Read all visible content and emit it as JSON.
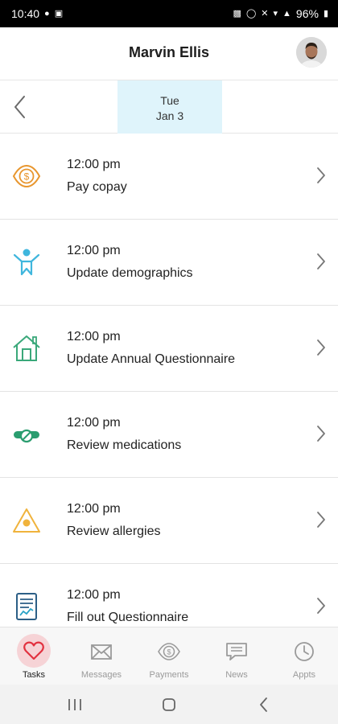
{
  "status_bar": {
    "time": "10:40",
    "battery": "96%"
  },
  "header": {
    "title": "Marvin Ellis"
  },
  "date_selector": {
    "day_of_week": "Tue",
    "date": "Jan 3"
  },
  "tasks": [
    {
      "time": "12:00 pm",
      "label": "Pay copay",
      "icon": "copay-icon",
      "color": "#e8962e"
    },
    {
      "time": "12:00 pm",
      "label": "Update demographics",
      "icon": "person-icon",
      "color": "#3fb6dd"
    },
    {
      "time": "12:00 pm",
      "label": "Update Annual Questionnaire",
      "icon": "house-icon",
      "color": "#3aa87a"
    },
    {
      "time": "12:00 pm",
      "label": "Review medications",
      "icon": "pills-icon",
      "color": "#2a9d6f"
    },
    {
      "time": "12:00 pm",
      "label": "Review allergies",
      "icon": "allergy-warning-icon",
      "color": "#f0b33c"
    },
    {
      "time": "12:00 pm",
      "label": "Fill out Questionnaire",
      "icon": "questionnaire-icon",
      "color": "#2c5f86"
    }
  ],
  "tab_bar": {
    "tabs": [
      {
        "label": "Tasks",
        "icon": "heart-icon",
        "active": true
      },
      {
        "label": "Messages",
        "icon": "envelope-icon",
        "active": false
      },
      {
        "label": "Payments",
        "icon": "dollar-circle-icon",
        "active": false
      },
      {
        "label": "News",
        "icon": "chat-bubble-icon",
        "active": false
      },
      {
        "label": "Appts",
        "icon": "clock-icon",
        "active": false
      }
    ],
    "active_color": "#e2313f"
  }
}
